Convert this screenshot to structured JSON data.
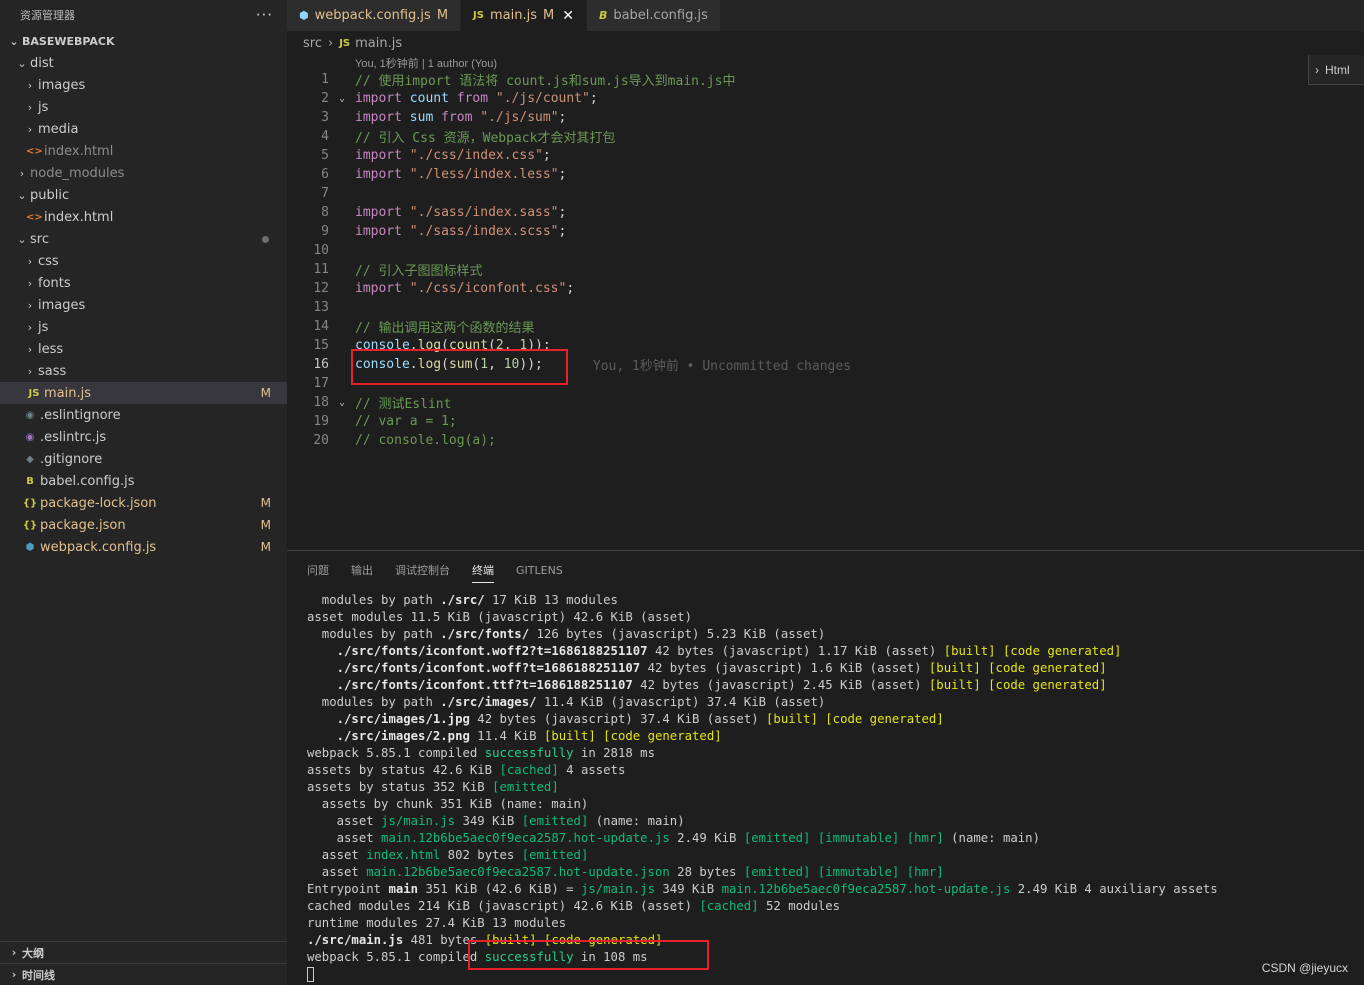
{
  "sidebar": {
    "title": "资源管理器",
    "more": "···",
    "root": "BASEWEBPACK",
    "tree": [
      {
        "label": "dist",
        "kind": "folder",
        "open": true,
        "depth": 1
      },
      {
        "label": "images",
        "kind": "folder",
        "open": false,
        "depth": 2
      },
      {
        "label": "js",
        "kind": "folder",
        "open": false,
        "depth": 2
      },
      {
        "label": "media",
        "kind": "folder",
        "open": false,
        "depth": 2
      },
      {
        "label": "index.html",
        "kind": "html",
        "depth": 2,
        "dim": true
      },
      {
        "label": "node_modules",
        "kind": "folder",
        "open": false,
        "depth": 1,
        "dim": true
      },
      {
        "label": "public",
        "kind": "folder",
        "open": true,
        "depth": 1
      },
      {
        "label": "index.html",
        "kind": "html",
        "depth": 2
      },
      {
        "label": "src",
        "kind": "folder",
        "open": true,
        "depth": 1,
        "dot": true
      },
      {
        "label": "css",
        "kind": "folder",
        "open": false,
        "depth": 2
      },
      {
        "label": "fonts",
        "kind": "folder",
        "open": false,
        "depth": 2
      },
      {
        "label": "images",
        "kind": "folder",
        "open": false,
        "depth": 2
      },
      {
        "label": "js",
        "kind": "folder",
        "open": false,
        "depth": 2
      },
      {
        "label": "less",
        "kind": "folder",
        "open": false,
        "depth": 2
      },
      {
        "label": "sass",
        "kind": "folder",
        "open": false,
        "depth": 2
      },
      {
        "label": "main.js",
        "kind": "js",
        "depth": 2,
        "badge": "M",
        "selected": true,
        "mod": true
      },
      {
        "label": ".eslintignore",
        "kind": "eslintignore",
        "depth": 1
      },
      {
        "label": ".eslintrc.js",
        "kind": "eslintrc",
        "depth": 1
      },
      {
        "label": ".gitignore",
        "kind": "gitignore",
        "depth": 1
      },
      {
        "label": "babel.config.js",
        "kind": "babel",
        "depth": 1
      },
      {
        "label": "package-lock.json",
        "kind": "json",
        "depth": 1,
        "badge": "M",
        "mod": true
      },
      {
        "label": "package.json",
        "kind": "json",
        "depth": 1,
        "badge": "M",
        "mod": true
      },
      {
        "label": "webpack.config.js",
        "kind": "webpack",
        "depth": 1,
        "badge": "M",
        "mod": true
      }
    ],
    "sections": [
      "大纲",
      "时间线"
    ]
  },
  "tabs": [
    {
      "label": "webpack.config.js",
      "badge": "M",
      "icon": "webpack"
    },
    {
      "label": "main.js",
      "badge": "M",
      "icon": "js",
      "active": true,
      "close": "✕"
    },
    {
      "label": "babel.config.js",
      "badge": "",
      "icon": "babel"
    }
  ],
  "breadcrumb": {
    "folder": "src",
    "sep": "›",
    "file": "main.js",
    "js_icon": "JS"
  },
  "editor": {
    "codelens": "You, 1秒钟前 | 1 author (You)",
    "html_peek": "Html",
    "blame": "You, 1秒钟前 • Uncommitted changes",
    "current_line": 16
  },
  "panel": {
    "tabs": [
      "问题",
      "输出",
      "调试控制台",
      "终端",
      "GITLENS"
    ],
    "active_tab": "终端"
  },
  "watermark": "CSDN @jieyucx",
  "colors": {
    "modified": "#e2c08d",
    "highlight_box": "#e8202a",
    "success": "#23d18b"
  }
}
